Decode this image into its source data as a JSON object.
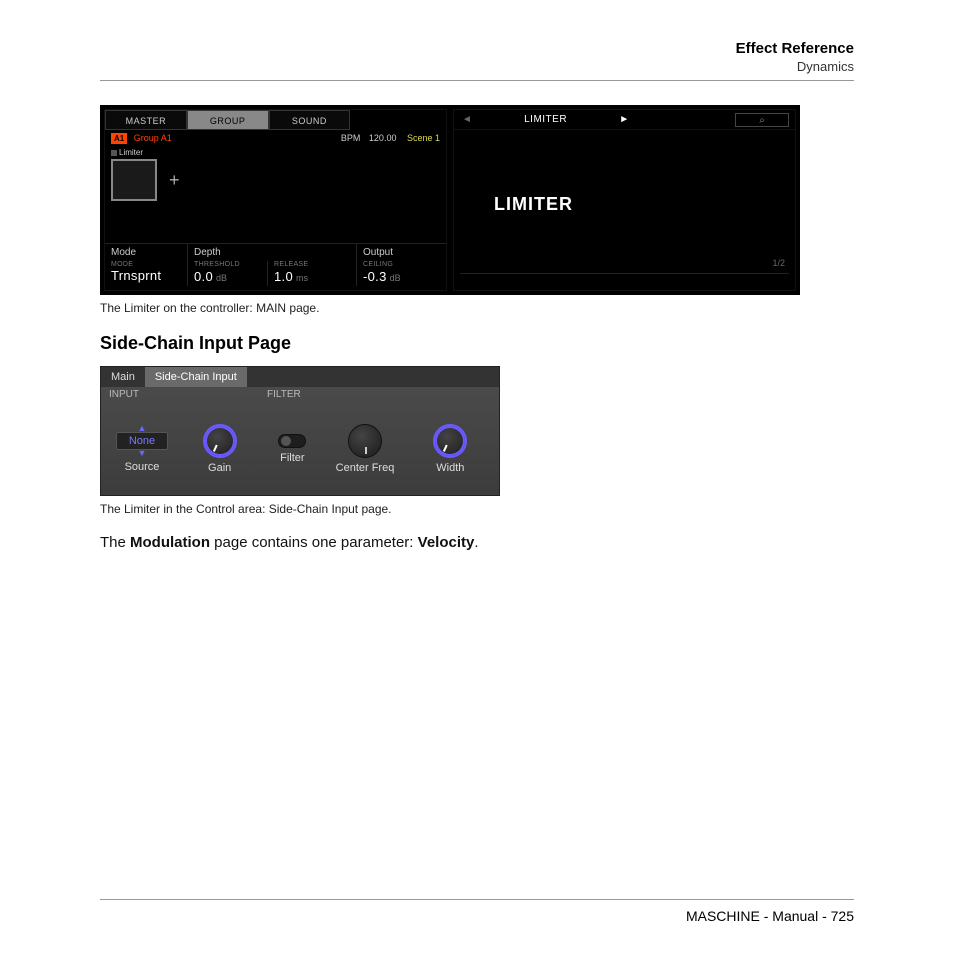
{
  "header": {
    "title": "Effect Reference",
    "subtitle": "Dynamics"
  },
  "figure1": {
    "tabs": {
      "master": "MASTER",
      "group": "GROUP",
      "sound": "SOUND"
    },
    "slot_badge": "A1",
    "group_name": "Group A1",
    "bpm_label": "BPM",
    "bpm_value": "120.00",
    "scene": "Scene 1",
    "chip_label": "Limiter",
    "section_headers": {
      "mode": "Mode",
      "depth": "Depth",
      "output": "Output"
    },
    "params": {
      "mode": {
        "label": "MODE",
        "value": "Trnsprnt",
        "unit": ""
      },
      "threshold": {
        "label": "THRESHOLD",
        "value": "0.0",
        "unit": "dB"
      },
      "release": {
        "label": "RELEASE",
        "value": "1.0",
        "unit": "ms"
      },
      "ceiling": {
        "label": "CEILING",
        "value": "-0.3",
        "unit": "dB"
      }
    },
    "right": {
      "title": "LIMITER",
      "big_title": "LIMITER",
      "page_indicator": "1/2"
    }
  },
  "caption1": "The Limiter on the controller: MAIN page.",
  "section_heading": "Side-Chain Input Page",
  "figure2": {
    "tabs": {
      "main": "Main",
      "sidechain": "Side-Chain Input"
    },
    "group_labels": {
      "input": "INPUT",
      "filter": "FILTER"
    },
    "source_value": "None",
    "knob_labels": {
      "source": "Source",
      "gain": "Gain",
      "filter": "Filter",
      "center": "Center Freq",
      "width": "Width"
    }
  },
  "caption2": "The Limiter in the Control area: Side-Chain Input page.",
  "body_sentence": {
    "pre": "The ",
    "b1": "Modulation",
    "mid": " page contains one parameter: ",
    "b2": "Velocity",
    "post": "."
  },
  "footer": "MASCHINE - Manual - 725"
}
